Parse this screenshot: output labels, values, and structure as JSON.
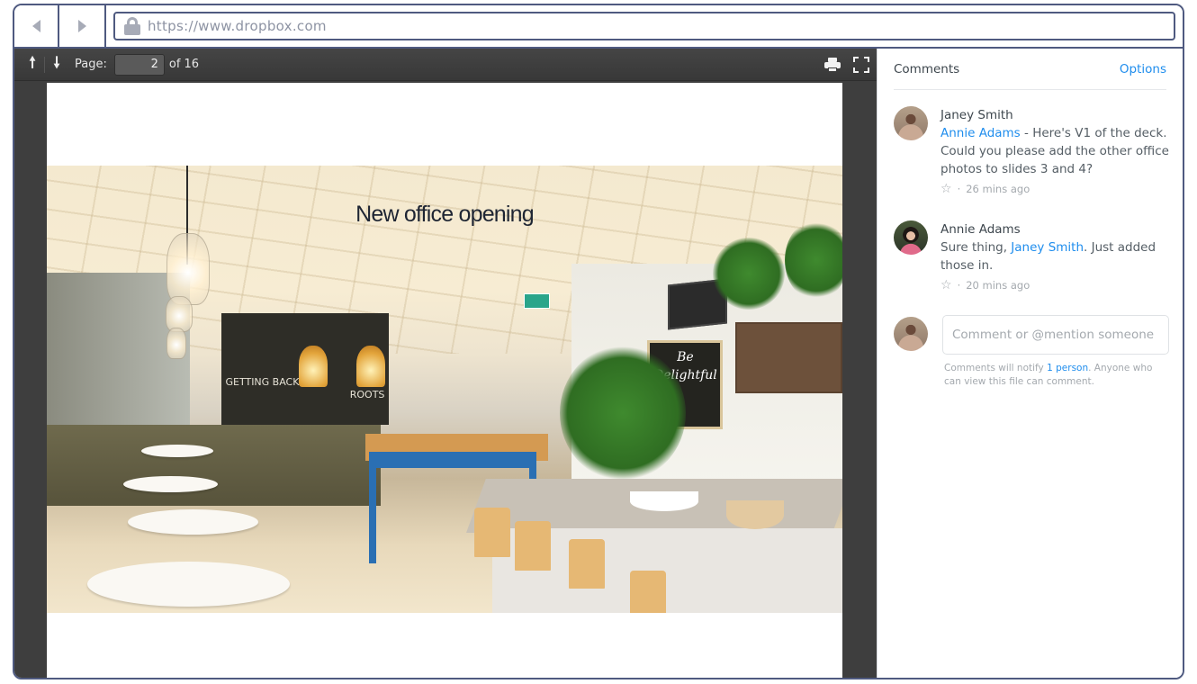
{
  "browser": {
    "url": "https://www.dropbox.com",
    "back_icon": "back-arrow-icon",
    "forward_icon": "forward-arrow-icon",
    "lock_icon": "lock-icon"
  },
  "viewer": {
    "toolbar": {
      "prev_icon": "arrow-up-icon",
      "next_icon": "arrow-down-icon",
      "page_label": "Page:",
      "current_page": "2",
      "total_pages_label": "of 16",
      "print_icon": "print-icon",
      "fullscreen_icon": "fullscreen-icon"
    },
    "slide": {
      "title": "New office opening",
      "chalkboard_left": "GETTING BACK TO",
      "chalkboard_right": "OUR ROOTS",
      "sign_text": "Be Delightful"
    }
  },
  "comments": {
    "title": "Comments",
    "options_label": "Options",
    "items": [
      {
        "author": "Janey Smith",
        "mention": "Annie Adams",
        "text": " - Here's V1 of the deck. Could you please add the other office photos to slides 3 and 4?",
        "time": "26 mins ago"
      },
      {
        "author": "Annie Adams",
        "text_before": "Sure thing, ",
        "mention": "Janey Smith",
        "text_after": ". Just added those in.",
        "time": "20 mins ago"
      }
    ],
    "new_comment": {
      "placeholder": "Comment or @mention someone",
      "note_before": "Comments will notify ",
      "note_link": "1 person",
      "note_after": ". Anyone who can view this file can comment."
    },
    "meta_separator": "·",
    "star_glyph": "☆"
  },
  "colors": {
    "accent": "#1f8ded",
    "frame": "#4f5a80",
    "viewer_bg": "#3e3e3e"
  }
}
